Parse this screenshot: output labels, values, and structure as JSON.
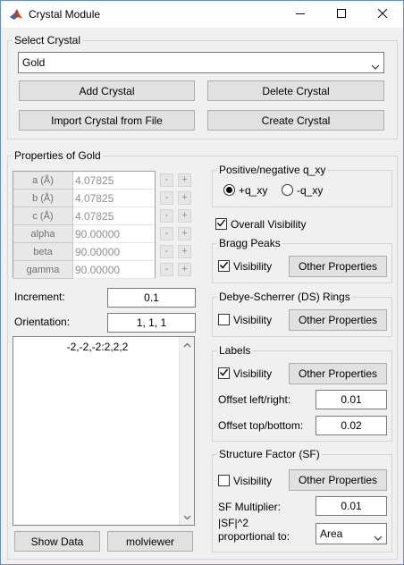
{
  "window": {
    "title": "Crystal Module"
  },
  "select_crystal": {
    "legend": "Select Crystal",
    "selected": "Gold",
    "add_label": "Add Crystal",
    "delete_label": "Delete Crystal",
    "import_label": "Import Crystal from File",
    "create_label": "Create Crystal"
  },
  "properties": {
    "legend": "Properties of Gold",
    "rows": [
      {
        "name": "a (Å)",
        "value": "4.07825"
      },
      {
        "name": "b (Å)",
        "value": "4.07825"
      },
      {
        "name": "c (Å)",
        "value": "4.07825"
      },
      {
        "name": "alpha",
        "value": "90.00000"
      },
      {
        "name": "beta",
        "value": "90.00000"
      },
      {
        "name": "gamma",
        "value": "90.00000"
      }
    ],
    "minus": "-",
    "plus": "+",
    "increment_label": "Increment:",
    "increment_value": "0.1",
    "orientation_label": "Orientation:",
    "orientation_value": "1, 1, 1",
    "hkl_text": "-2,-2,-2:2,2,2",
    "show_data_label": "Show Data",
    "molviewer_label": "molviewer"
  },
  "qxy": {
    "legend": "Positive/negative q_xy",
    "option_pos": "+q_xy",
    "option_neg": "-q_xy",
    "selected": "+q_xy"
  },
  "overall_visibility": {
    "label": "Overall Visibility",
    "checked": true
  },
  "bragg": {
    "legend": "Bragg Peaks",
    "visibility_label": "Visibility",
    "checked": true,
    "other_label": "Other Properties"
  },
  "ds_rings": {
    "legend": "Debye-Scherrer (DS) Rings",
    "visibility_label": "Visibility",
    "checked": false,
    "other_label": "Other Properties"
  },
  "labels": {
    "legend": "Labels",
    "visibility_label": "Visibility",
    "checked": true,
    "other_label": "Other Properties",
    "offset_lr_label": "Offset left/right:",
    "offset_lr_value": "0.01",
    "offset_tb_label": "Offset top/bottom:",
    "offset_tb_value": "0.02"
  },
  "structure_factor": {
    "legend": "Structure Factor (SF)",
    "visibility_label": "Visibility",
    "checked": false,
    "other_label": "Other Properties",
    "multiplier_label": "SF Multiplier:",
    "multiplier_value": "0.01",
    "proportional_line1": "|SF|^2",
    "proportional_line2": "proportional to:",
    "proportional_selected": "Area"
  },
  "icons": {
    "app": "matlab-icon",
    "minimize": "minimize-icon",
    "maximize": "maximize-icon",
    "close": "close-icon",
    "dropdown": "chevron-down-icon",
    "check": "checkmark-icon"
  }
}
